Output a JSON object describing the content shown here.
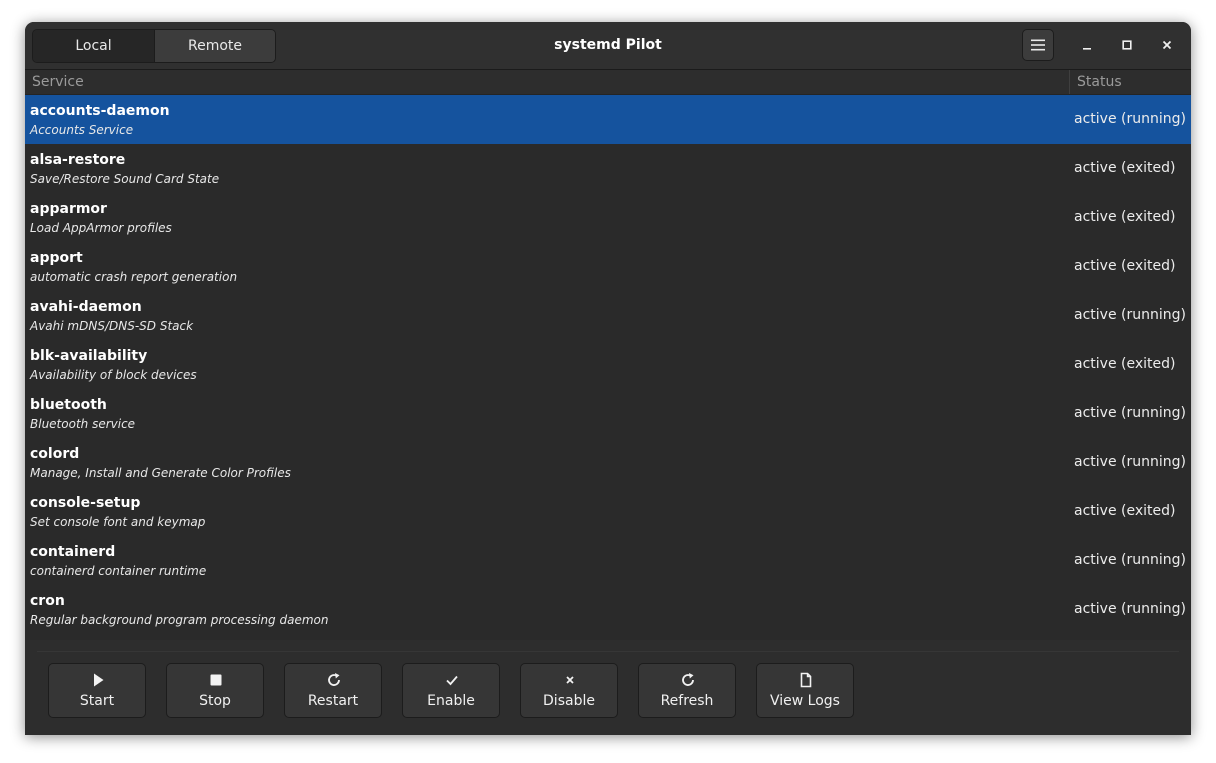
{
  "window": {
    "title": "systemd Pilot",
    "mode_switcher": [
      "Local",
      "Remote"
    ],
    "active_mode": "Local"
  },
  "table": {
    "columns": {
      "service": "Service",
      "status": "Status"
    },
    "rows": [
      {
        "name": "accounts-daemon",
        "description": "Accounts Service",
        "status": "active (running)",
        "selected": true
      },
      {
        "name": "alsa-restore",
        "description": "Save/Restore Sound Card State",
        "status": "active (exited)"
      },
      {
        "name": "apparmor",
        "description": "Load AppArmor profiles",
        "status": "active (exited)"
      },
      {
        "name": "apport",
        "description": "automatic crash report generation",
        "status": "active (exited)"
      },
      {
        "name": "avahi-daemon",
        "description": "Avahi mDNS/DNS-SD Stack",
        "status": "active (running)"
      },
      {
        "name": "blk-availability",
        "description": "Availability of block devices",
        "status": "active (exited)"
      },
      {
        "name": "bluetooth",
        "description": "Bluetooth service",
        "status": "active (running)"
      },
      {
        "name": "colord",
        "description": "Manage, Install and Generate Color Profiles",
        "status": "active (running)"
      },
      {
        "name": "console-setup",
        "description": "Set console font and keymap",
        "status": "active (exited)"
      },
      {
        "name": "containerd",
        "description": "containerd container runtime",
        "status": "active (running)"
      },
      {
        "name": "cron",
        "description": "Regular background program processing daemon",
        "status": "active (running)"
      }
    ]
  },
  "toolbar": {
    "start_label": "Start",
    "stop_label": "Stop",
    "restart_label": "Restart",
    "enable_label": "Enable",
    "disable_label": "Disable",
    "refresh_label": "Refresh",
    "view_logs_label": "View Logs"
  },
  "icons": {
    "start": "play-icon",
    "stop": "stop-square-icon",
    "restart": "restart-icon",
    "enable": "checkmark-icon",
    "disable": "x-mark-icon",
    "refresh": "refresh-icon",
    "view_logs": "document-icon",
    "menu": "hamburger-menu-icon"
  },
  "colors": {
    "selection": "#15539e",
    "window_bg": "#2d2d2d"
  }
}
